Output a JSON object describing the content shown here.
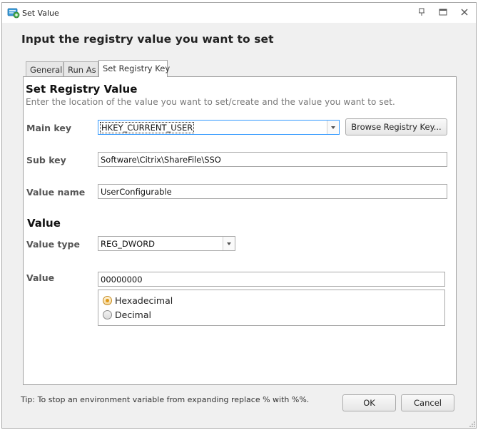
{
  "window": {
    "title": "Set Value",
    "icons": {
      "app": "registry-app-icon",
      "pin": "pin-icon",
      "maximize": "maximize-icon",
      "close": "close-icon"
    }
  },
  "header": {
    "title": "Input the registry value you want to set"
  },
  "tabs": [
    {
      "label": "General",
      "active": false
    },
    {
      "label": "Run As",
      "active": false
    },
    {
      "label": "Set Registry Key",
      "active": true
    }
  ],
  "registry": {
    "section_title": "Set Registry Value",
    "description": "Enter the location of the value you want to set/create and the value you want to set.",
    "main_key": {
      "label": "Main key",
      "value": "HKEY_CURRENT_USER"
    },
    "browse_button": "Browse Registry Key...",
    "sub_key": {
      "label": "Sub key",
      "value": "Software\\Citrix\\ShareFile\\SSO"
    },
    "value_name": {
      "label": "Value name",
      "value": "UserConfigurable"
    }
  },
  "value_section": {
    "title": "Value",
    "value_type": {
      "label": "Value type",
      "value": "REG_DWORD"
    },
    "value": {
      "label": "Value",
      "value": "00000000"
    },
    "format_options": [
      {
        "label": "Hexadecimal",
        "selected": true
      },
      {
        "label": "Decimal",
        "selected": false
      }
    ]
  },
  "footer": {
    "tip": "Tip: To stop an environment variable from expanding replace % with %%.",
    "ok": "OK",
    "cancel": "Cancel"
  },
  "colors": {
    "window_bg": "#f0f0f0",
    "focus": "#3399ff",
    "radio_selected": "#e09a1a"
  }
}
